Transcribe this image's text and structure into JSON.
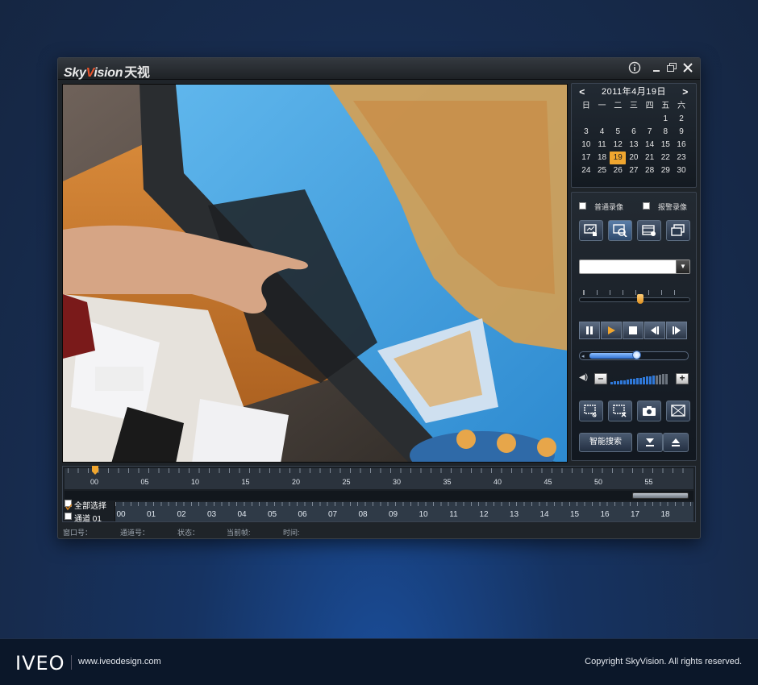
{
  "window": {
    "logo_text": "SkyVision",
    "logo_cn": "天视",
    "info_label": "ⓘ",
    "minimize_label": "–",
    "restore_label": "⧉",
    "close_label": "✕"
  },
  "calendar": {
    "title": "2011年4月19日",
    "prev_label": "<",
    "next_label": ">",
    "weekdays": [
      "日",
      "一",
      "二",
      "三",
      "四",
      "五",
      "六"
    ],
    "days": [
      "",
      "",
      "",
      "",
      "",
      "1",
      "2",
      "3",
      "4",
      "5",
      "6",
      "7",
      "8",
      "9",
      "10",
      "11",
      "12",
      "13",
      "14",
      "15",
      "16",
      "17",
      "18",
      "19",
      "20",
      "21",
      "22",
      "23",
      "24",
      "25",
      "26",
      "27",
      "28",
      "29",
      "30"
    ],
    "selected_day": "19"
  },
  "controls": {
    "normal_record_label": "普通录像",
    "alarm_record_label": "报警录像",
    "normal_record_checked": false,
    "alarm_record_checked": false,
    "dropdown_value": "",
    "speed_slider_fraction": 0.55,
    "playback_progress_fraction": 0.52,
    "volume_level_fraction": 0.75,
    "smart_search_label": "智能搜索",
    "accent_color": "#f0a62f"
  },
  "timeline": {
    "minute_labels": [
      "00",
      "05",
      "10",
      "15",
      "20",
      "25",
      "30",
      "35",
      "40",
      "45",
      "50",
      "55"
    ],
    "hour_labels": [
      "00",
      "01",
      "02",
      "03",
      "04",
      "05",
      "06",
      "07",
      "08",
      "09",
      "10",
      "11",
      "12",
      "13",
      "14",
      "15",
      "16",
      "17",
      "18"
    ],
    "select_all_label": "全部选择",
    "select_all_checked": true,
    "channel_label": "通道 01",
    "channel_checked": false
  },
  "status": {
    "window_no": "窗口号：",
    "channel_no": "通道号：",
    "state": "状态：",
    "current_frame": "当前帧:",
    "time": "时间:"
  },
  "footer": {
    "brand": "IVEO",
    "url": "www.iveodesign.com",
    "copyright": "Copyright SkyVision. All rights reserved."
  }
}
